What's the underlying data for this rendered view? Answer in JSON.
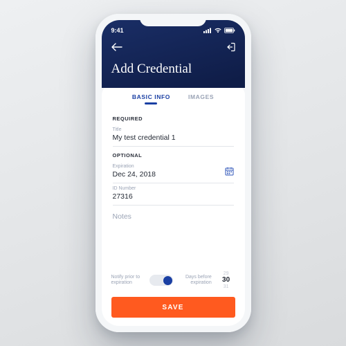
{
  "status": {
    "time": "9:41"
  },
  "header": {
    "title": "Add Credential"
  },
  "tabs": {
    "basic": "BASIC INFO",
    "images": "IMAGES"
  },
  "sections": {
    "required": "REQUIRED",
    "optional": "OPTIONAL"
  },
  "fields": {
    "title": {
      "label": "Title",
      "value": "My test credential 1"
    },
    "expiration": {
      "label": "Expiration",
      "value": "Dec 24, 2018"
    },
    "idnumber": {
      "label": "ID Number",
      "value": "27316"
    },
    "notes": {
      "placeholder": "Notes"
    }
  },
  "notify": {
    "leftLabel": "Notify prior to expiration",
    "rightLabel": "Days before expiration",
    "picker": {
      "prev": "29",
      "current": "30",
      "next": "31"
    }
  },
  "actions": {
    "save": "SAVE"
  }
}
